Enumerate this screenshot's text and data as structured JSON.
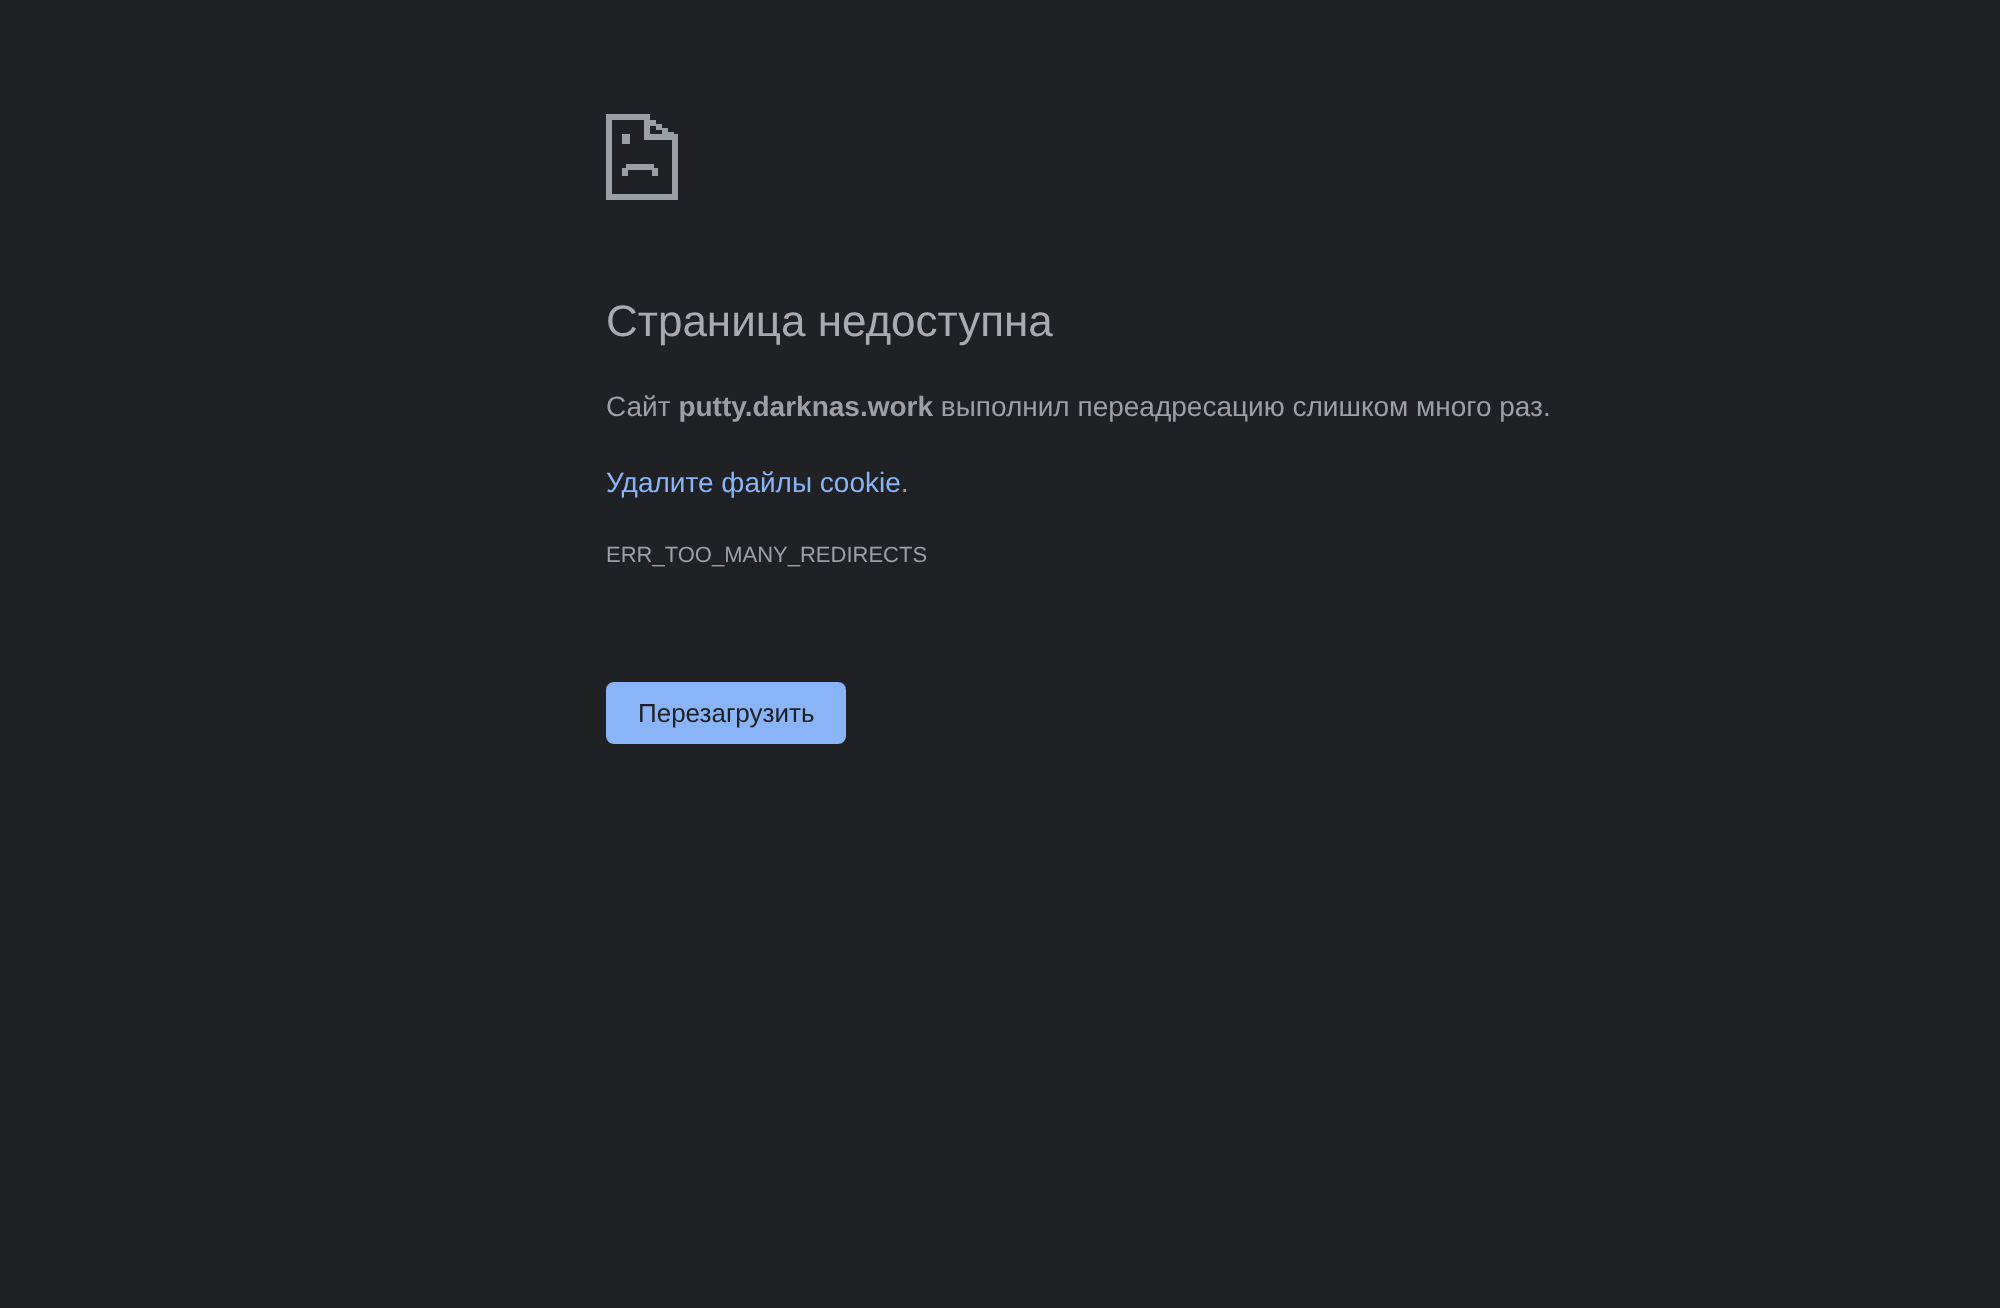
{
  "heading": "Страница недоступна",
  "description": "Сайт **putty.darknas.work** выполнил переадресацию слишком много раз.",
  "suggestion": {
    "link": "Удалите файлы cookie",
    "suffix": "."
  },
  "error_code": "ERR_TOO_MANY_REDIRECTS",
  "buttons": [
    {
      "label": "Перезагрузить",
      "kind": "primary"
    }
  ]
}
